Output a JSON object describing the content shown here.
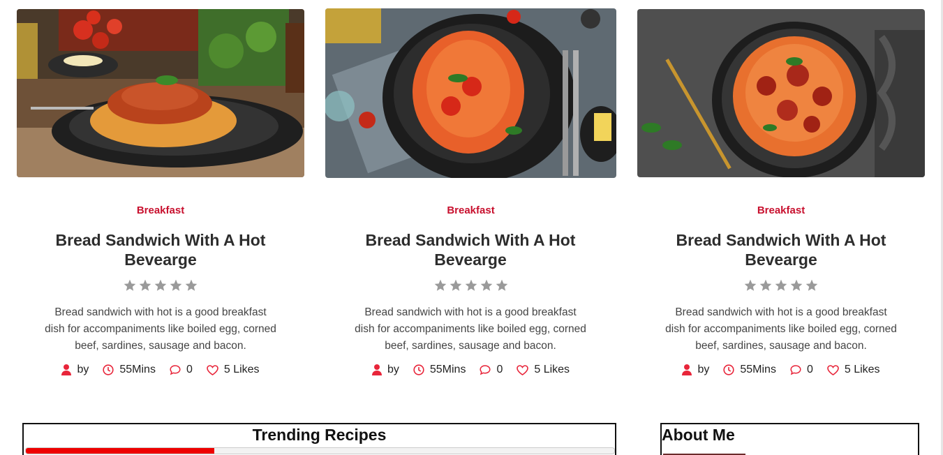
{
  "cards": [
    {
      "category": "Breakfast",
      "title": "Bread Sandwich With A Hot Bevearge",
      "description": "Bread sandwich with hot is a good breakfast dish for accompaniments like boiled egg, corned beef, sardines, sausage and bacon.",
      "rating": 0,
      "author_label": "by",
      "time": "55Mins",
      "comments": "0",
      "likes": "5 Likes"
    },
    {
      "category": "Breakfast",
      "title": "Bread Sandwich With A Hot Bevearge",
      "description": "Bread sandwich with hot is a good breakfast dish for accompaniments like boiled egg, corned beef, sardines, sausage and bacon.",
      "rating": 0,
      "author_label": "by",
      "time": "55Mins",
      "comments": "0",
      "likes": "5 Likes"
    },
    {
      "category": "Breakfast",
      "title": "Bread Sandwich With A Hot Bevearge",
      "description": "Bread sandwich with hot is a good breakfast dish for accompaniments like boiled egg, corned beef, sardines, sausage and bacon.",
      "rating": 0,
      "author_label": "by",
      "time": "55Mins",
      "comments": "0",
      "likes": "5 Likes"
    }
  ],
  "trending": {
    "heading": "Trending Recipes",
    "progress": 0.32
  },
  "about": {
    "heading": "About Me"
  },
  "colors": {
    "accent": "#c8102e",
    "icon_red": "#e8253a",
    "star_gray": "#9a9a9a",
    "progress": "#ee0000"
  },
  "icons": [
    "user-icon",
    "clock-icon",
    "comment-icon",
    "heart-icon",
    "star-icon"
  ]
}
